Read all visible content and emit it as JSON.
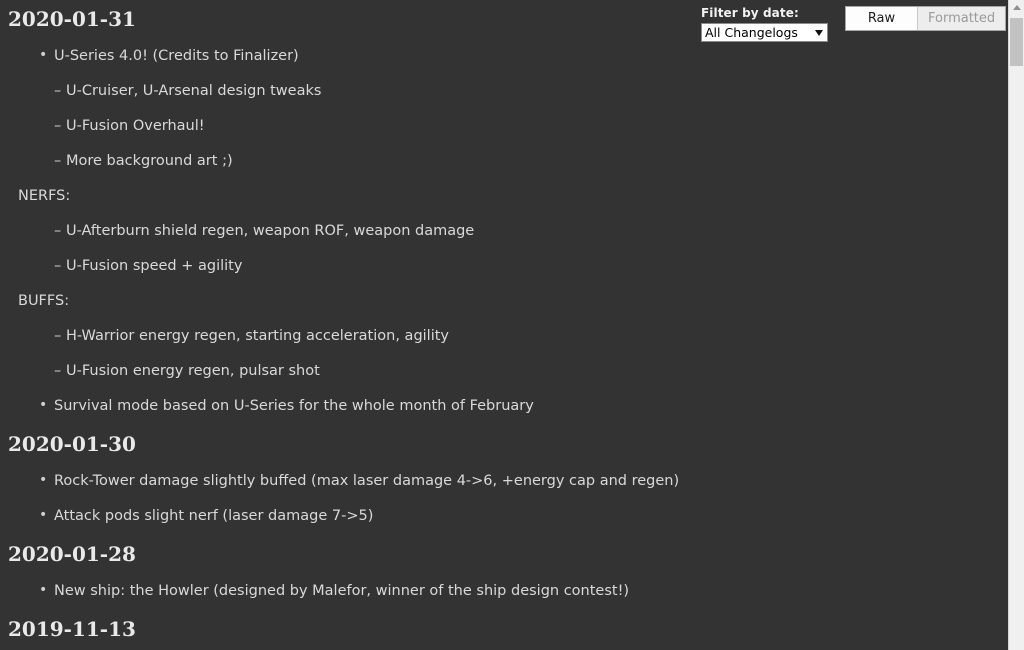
{
  "toolbar": {
    "filter_label": "Filter by date:",
    "filter_selected": "All Changelogs",
    "filter_options": [
      "All Changelogs"
    ],
    "dropdown_icon": "chevron-down-icon",
    "view_modes": [
      {
        "label": "Raw",
        "active": true
      },
      {
        "label": "Formatted",
        "active": false
      }
    ]
  },
  "scrollbar": {
    "up_arrow_icon": "chevron-up-icon",
    "orientation": "vertical"
  },
  "colors": {
    "background": "#333333",
    "heading_text": "#e9e9e9",
    "body_text": "#d9d9d9",
    "control_text": "#f2f2f2",
    "button_active_bg": "#fdfdfd",
    "button_inactive_bg": "#ededed",
    "scrollbar_track": "#f0f0f0",
    "scrollbar_thumb": "#c2c2c2"
  },
  "changelog": [
    {
      "date": "2020-01-31",
      "entries": [
        {
          "level": "bullet",
          "text": "U-Series 4.0! (Credits to Finalizer)"
        },
        {
          "level": "dash",
          "text": "U-Cruiser, U-Arsenal design tweaks"
        },
        {
          "level": "dash",
          "text": "U-Fusion Overhaul!"
        },
        {
          "level": "dash",
          "text": "More background art ;)"
        },
        {
          "level": "plain",
          "text": "NERFS:"
        },
        {
          "level": "dash",
          "text": "U-Afterburn shield regen, weapon ROF, weapon damage"
        },
        {
          "level": "dash",
          "text": "U-Fusion speed + agility"
        },
        {
          "level": "plain",
          "text": "BUFFS:"
        },
        {
          "level": "dash",
          "text": "H-Warrior energy regen, starting acceleration, agility"
        },
        {
          "level": "dash",
          "text": "U-Fusion energy regen, pulsar shot"
        },
        {
          "level": "bullet",
          "text": "Survival mode based on U-Series for the whole month of February"
        }
      ]
    },
    {
      "date": "2020-01-30",
      "entries": [
        {
          "level": "bullet",
          "text": "Rock-Tower damage slightly buffed (max laser damage 4->6, +energy cap and regen)"
        },
        {
          "level": "bullet",
          "text": "Attack pods slight nerf (laser damage 7->5)"
        }
      ]
    },
    {
      "date": "2020-01-28",
      "entries": [
        {
          "level": "bullet",
          "text": "New ship: the Howler (designed by Malefor, winner of the ship design contest!)"
        }
      ]
    },
    {
      "date": "2019-11-13",
      "entries": []
    }
  ]
}
